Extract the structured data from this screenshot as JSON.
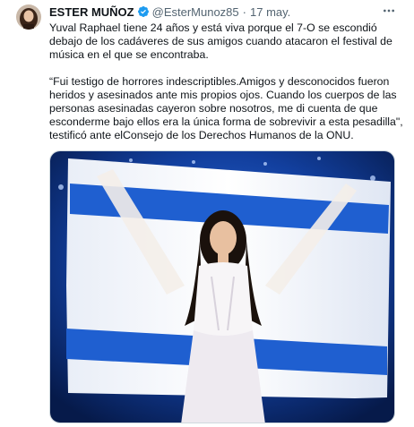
{
  "author": {
    "name": "ESTER MUÑOZ",
    "handle": "@EsterMunoz85",
    "separator": "·",
    "timestamp": "17 may.",
    "verified_color": "#1d9bf0"
  },
  "more_icon": "more-horizontal-icon",
  "tweet": {
    "paragraph1": "Yuval Raphael tiene 24 años y está viva porque el 7-O se escondió debajo de los cadáveres de sus amigos cuando atacaron el festival de música en el que se encontraba.",
    "paragraph2": "“Fui testigo de horrores indescriptibles.Amigos y desconocidos fueron heridos y asesinados ante mis propios ojos. Cuando los cuerpos de las personas asesinadas cayeron sobre nosotros, me di cuenta de que esconderme bajo ellos era la única forma de sobrevivir a esta pesadilla\", testificó ante elConsejo de los Derechos Humanos de la ONU."
  },
  "media": {
    "description_icon": "photo-woman-holding-flag",
    "flag_blue": "#1f5fd0",
    "background": "#0b2a6a"
  }
}
